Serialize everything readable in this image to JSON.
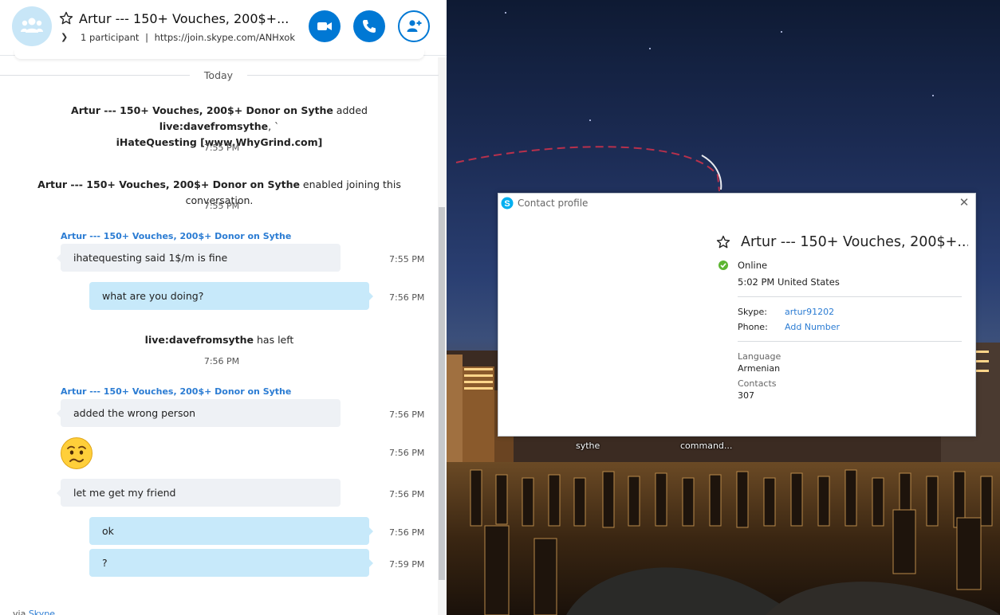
{
  "conversation": {
    "title": "Artur --- 150+ Vouches, 200$+...",
    "participants": "1 participant",
    "join_link": "https://join.skype.com/ANHxokR...",
    "separator": "|"
  },
  "day_label": "Today",
  "system_messages": [
    {
      "line1_bold": "Artur --- 150+ Vouches, 200$+ Donor on Sythe",
      "line1_text": " added ",
      "line1_bold2": "live:davefromsythe",
      "line1_tail": ", `",
      "line2_bold": "iHateQuesting [www.WhyGrind.com]",
      "time": "7:55 PM"
    },
    {
      "bold": "Artur --- 150+ Vouches, 200$+ Donor on Sythe",
      "text": " enabled joining this conversation.",
      "time": "7:55 PM"
    },
    {
      "bold": "live:davefromsythe",
      "text": " has left",
      "time": "7:56 PM"
    }
  ],
  "sender_name": "Artur --- 150+ Vouches, 200$+ Donor on Sythe",
  "messages": [
    {
      "text": "ihatequesting said 1$/m is fine",
      "time": "7:55 PM"
    },
    {
      "text": "what are you doing?",
      "time": "7:56 PM"
    },
    {
      "text": "added the wrong person",
      "time": "7:56 PM"
    },
    {
      "emoji": "worried-face-emoji",
      "time": "7:56 PM"
    },
    {
      "text": "let me get my friend",
      "time": "7:56 PM"
    },
    {
      "text": "ok",
      "time": "7:56 PM"
    },
    {
      "text": "?",
      "time": "7:59 PM"
    }
  ],
  "footer": {
    "via": "via ",
    "link": "Skype"
  },
  "desktop": {
    "icons": [
      {
        "label": "sythe"
      },
      {
        "label": "command..."
      }
    ]
  },
  "profile": {
    "window_title": "Contact profile",
    "name": "Artur --- 150+ Vouches, 200$+...",
    "status": "Online",
    "local_time": "5:02 PM United States",
    "skype_label": "Skype:",
    "skype_id": "artur91202",
    "phone_label": "Phone:",
    "phone_action": "Add Number",
    "language_label": "Language",
    "language": "Armenian",
    "contacts_label": "Contacts",
    "contacts": "307"
  },
  "colors": {
    "accent": "#0078d4",
    "link": "#2b7cd3",
    "outgoing_bubble": "#c7e9fa",
    "incoming_bubble": "#eef1f5",
    "online": "#5cb531"
  }
}
